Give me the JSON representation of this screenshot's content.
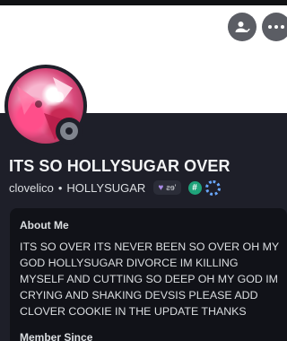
{
  "profile": {
    "display_name": "ITS SO HOLLYSUGAR OVER",
    "username": "clovelico",
    "separator": "•",
    "pronouns": "HOLLYSUGAR",
    "tag_text": "ƨɘ'",
    "status": "offline"
  },
  "about": {
    "heading": "About Me",
    "text": "ITS SO OVER ITS NEVER BEEN SO OVER OH MY GOD HOLLYSUGAR DIVORCE IM KILLING MYSELF AND CUTTING SO DEEP OH MY GOD IM CRYING AND SHAKING DEVSIS PLEASE ADD CLOVER COOKIE IN THE UPDATE THANKS"
  },
  "member_since": {
    "heading": "Member Since"
  },
  "badges": {
    "hash": "#"
  },
  "icons": {
    "friend": "add-friend-icon",
    "more": "more-options-icon",
    "heart": "heart-icon",
    "hash": "hashtag-badge-icon",
    "ring": "nitro-ring-badge-icon"
  },
  "colors": {
    "panel": "#1e1f29",
    "card": "#111218",
    "button": "#5b5d64",
    "status_offline": "#80848e",
    "badge_green": "#1fa37a",
    "badge_blue": "#6aa8ff"
  }
}
